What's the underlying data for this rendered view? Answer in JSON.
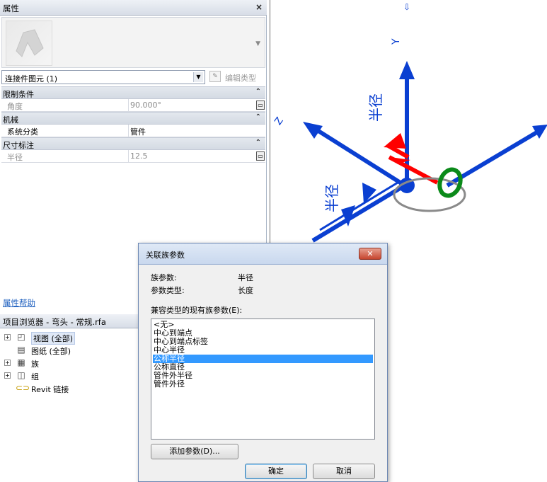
{
  "properties": {
    "title": "属性",
    "close": "×",
    "instance_selector": "连接件图元 (1)",
    "edit_type": "编辑类型",
    "categories": [
      {
        "label": "限制条件",
        "collapse": "⌃",
        "rows": [
          {
            "name": "角度",
            "value": "90.000°",
            "disabled": true
          }
        ]
      },
      {
        "label": "机械",
        "collapse": "⌃",
        "rows": [
          {
            "name": "系统分类",
            "value": "管件",
            "disabled": false
          }
        ]
      },
      {
        "label": "尺寸标注",
        "collapse": "⌃",
        "rows": [
          {
            "name": "半径",
            "value": "12.5",
            "disabled": true
          }
        ]
      }
    ],
    "help_link": "属性帮助"
  },
  "project_browser": {
    "title": "项目浏览器 - 弯头 - 常规.rfa",
    "items": [
      {
        "label": "视图 (全部)",
        "icon": "views-icon",
        "expandable": true
      },
      {
        "label": "图纸 (全部)",
        "icon": "sheets-icon",
        "expandable": false
      },
      {
        "label": "族",
        "icon": "families-icon",
        "expandable": true
      },
      {
        "label": "组",
        "icon": "groups-icon",
        "expandable": true
      },
      {
        "label": "Revit 链接",
        "icon": "link-icon",
        "expandable": false
      }
    ]
  },
  "viewport": {
    "labels": {
      "y_axis": "Y",
      "z_axis": "Z",
      "radius_top": "半径",
      "radius_left": "半径"
    }
  },
  "dialog": {
    "title": "关联族参数",
    "param_label": "族参数:",
    "param_value": "半径",
    "type_label": "参数类型:",
    "type_value": "长度",
    "list_label": "兼容类型的现有族参数(E):",
    "list_items": [
      "<无>",
      "中心到端点",
      "中心到端点标签",
      "中心半径",
      "公称半径",
      "公称直径",
      "管件外半径",
      "管件外径"
    ],
    "selected_index": 4,
    "add_param_button": "添加参数(D)...",
    "ok_button": "确定",
    "cancel_button": "取消",
    "colors": {
      "selection": "#3399ff",
      "axis_blue": "#0a3fd1",
      "axis_red": "#ff0000",
      "axis_green": "#0b8a1a"
    }
  }
}
